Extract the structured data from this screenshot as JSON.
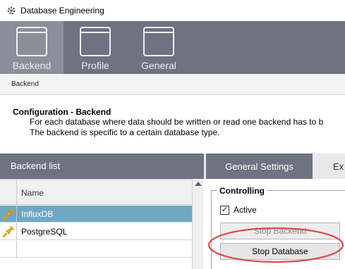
{
  "window": {
    "title": "Database Engineering"
  },
  "ribbon": {
    "items": [
      {
        "label": "Backend",
        "active": true
      },
      {
        "label": "Profile",
        "active": false
      },
      {
        "label": "General",
        "active": false
      }
    ]
  },
  "breadcrumb": {
    "text": "Backend"
  },
  "config": {
    "title": "Configuration - Backend",
    "line1": "For each database where data should be written or read one backend has to b",
    "line2": "The backend is specific to a certain database type."
  },
  "backend_list": {
    "header": "Backend list",
    "column": "Name",
    "rows": [
      {
        "name": "InfluxDB",
        "selected": true
      },
      {
        "name": "PostgreSQL",
        "selected": false
      }
    ]
  },
  "settings": {
    "tabs": [
      "General Settings",
      "Ex"
    ],
    "group_title": "Controlling",
    "active_label": "Active",
    "active_checked": true,
    "stop_backend": "Stop Backend",
    "stop_database": "Stop Database"
  },
  "colors": {
    "ribbon": "#6d7380",
    "selected_row": "#6fa7c3",
    "highlight": "#e0474c"
  }
}
